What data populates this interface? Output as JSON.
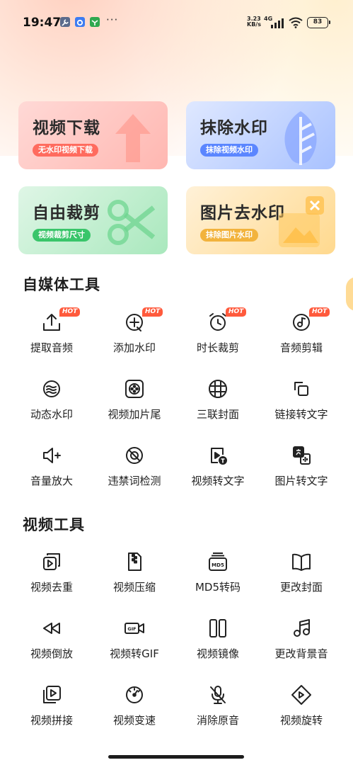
{
  "status_bar": {
    "time": "19:47",
    "more": "···",
    "speed_value": "3.23",
    "speed_unit": "KB/s",
    "network": "4G",
    "battery": "83"
  },
  "feature_cards": [
    {
      "title": "视频下载",
      "subtitle": "无水印视频下载",
      "color": "#ff6b5e"
    },
    {
      "title": "抹除水印",
      "subtitle": "抹除视频水印",
      "color": "#5b86ff"
    },
    {
      "title": "自由裁剪",
      "subtitle": "视频裁剪尺寸",
      "color": "#39c56a"
    },
    {
      "title": "图片去水印",
      "subtitle": "抹除图片水印",
      "color": "#f2b33d"
    }
  ],
  "sections": [
    {
      "title": "自媒体工具",
      "items": [
        {
          "label": "提取音频",
          "icon": "upload-icon",
          "hot": "HOT"
        },
        {
          "label": "添加水印",
          "icon": "add-watermark-icon",
          "hot": "HOT"
        },
        {
          "label": "时长裁剪",
          "icon": "alarm-clock-icon",
          "hot": "HOT"
        },
        {
          "label": "音频剪辑",
          "icon": "audio-disc-icon",
          "hot": "HOT"
        },
        {
          "label": "动态水印",
          "icon": "wave-icon"
        },
        {
          "label": "视频加片尾",
          "icon": "film-reel-icon"
        },
        {
          "label": "三联封面",
          "icon": "grid-icon"
        },
        {
          "label": "链接转文字",
          "icon": "link-copy-icon"
        },
        {
          "label": "音量放大",
          "icon": "volume-plus-icon"
        },
        {
          "label": "违禁词检测",
          "icon": "forbidden-icon"
        },
        {
          "label": "视频转文字",
          "icon": "video-to-text-icon"
        },
        {
          "label": "图片转文字",
          "icon": "image-to-text-icon"
        }
      ]
    },
    {
      "title": "视频工具",
      "items": [
        {
          "label": "视频去重",
          "icon": "dedupe-icon"
        },
        {
          "label": "视频压缩",
          "icon": "zip-file-icon"
        },
        {
          "label": "MD5转码",
          "icon": "md5-icon"
        },
        {
          "label": "更改封面",
          "icon": "book-icon"
        },
        {
          "label": "视频倒放",
          "icon": "rewind-icon"
        },
        {
          "label": "视频转GIF",
          "icon": "gif-icon"
        },
        {
          "label": "视频镜像",
          "icon": "mirror-icon"
        },
        {
          "label": "更改背景音",
          "icon": "music-note-icon"
        },
        {
          "label": "视频拼接",
          "icon": "stack-play-icon"
        },
        {
          "label": "视频变速",
          "icon": "speed-gauge-icon"
        },
        {
          "label": "消除原音",
          "icon": "mic-off-icon"
        },
        {
          "label": "视频旋转",
          "icon": "rotate-diamond-icon"
        }
      ]
    }
  ]
}
